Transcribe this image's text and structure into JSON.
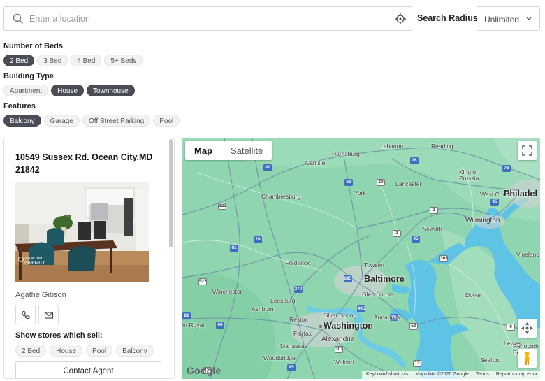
{
  "search": {
    "placeholder": "Enter a location",
    "value": ""
  },
  "radius": {
    "label": "Search Radius",
    "selected": "Unlimited"
  },
  "filters": {
    "beds": {
      "title": "Number of Beds",
      "options": [
        "2 Bed",
        "3 Bed",
        "4 Bed",
        "5+ Beds"
      ],
      "selected": [
        "2 Bed"
      ]
    },
    "building": {
      "title": "Building Type",
      "options": [
        "Apartment",
        "House",
        "Townhouse"
      ],
      "selected": [
        "House",
        "Townhouse"
      ]
    },
    "features": {
      "title": "Features",
      "options": [
        "Balcony",
        "Garage",
        "Off Street Parking",
        "Pool"
      ],
      "selected": [
        "Balcony"
      ]
    }
  },
  "listing": {
    "address": "10549 Sussex Rd. Ocean City,MD 21842",
    "agent_name": "Agathe Gibson",
    "stores_title": "Show stores which sell:",
    "store_tags": [
      "2 Bed",
      "House",
      "Pool",
      "Balcony"
    ],
    "contact_label": "Contact Agent",
    "photo_watermark": "DIAMOND PROPERTY"
  },
  "map": {
    "tabs": [
      "Map",
      "Satellite"
    ],
    "active_tab": "Map",
    "logo": "Google",
    "attribution": [
      "Keyboard shortcuts",
      "Map data ©2026 Google",
      "Terms",
      "Report a map error"
    ],
    "places": {
      "lebanon": "Lebanon",
      "reading": "Reading",
      "harrisburg": "Harrisburg",
      "carlisle": "Carlisle",
      "lancaster": "Lancaster",
      "york": "York",
      "king_of_prussia": "King of Prussia",
      "chambersburg": "Chambersburg",
      "west_chester": "West Chester",
      "philadelphia": "Philadel",
      "wilmington": "Wilmington",
      "newark": "Newark",
      "frederick": "Frederick",
      "towson": "Towson",
      "vineland": "Vineland",
      "baltimore": "Baltimore",
      "winchester": "Winchester",
      "glen_burnie": "Glen Burnie",
      "leesburg": "Leesburg",
      "dover": "Dover",
      "ashburn": "Ashburn",
      "silver_spring": "Silver Spring",
      "reston": "Reston",
      "annapolis": "Annapolis",
      "front_royal": "nt Royal",
      "washington": "Washington",
      "fairfax": "Fairfax",
      "alexandria": "Alexandria",
      "manassas": "Manassas",
      "lewes": "Lewes",
      "rehoboth": "Rehoboth Beach",
      "woodbridge": "Woodbridge",
      "waldorf": "Waldorf",
      "seaford": "Seaford"
    },
    "route_shields": [
      "81",
      "76",
      "83",
      "30",
      "76",
      "276",
      "322",
      "1",
      "95",
      "83",
      "70",
      "1",
      "95",
      "81",
      "301",
      "70",
      "522",
      "270",
      "695",
      "495",
      "81",
      "66",
      "50",
      "95",
      "301",
      "211",
      "95",
      "9"
    ]
  },
  "colors": {
    "chip_selected": "#4a4d55",
    "map_land": "#8fd6b0",
    "map_water": "#5fc3e6"
  }
}
